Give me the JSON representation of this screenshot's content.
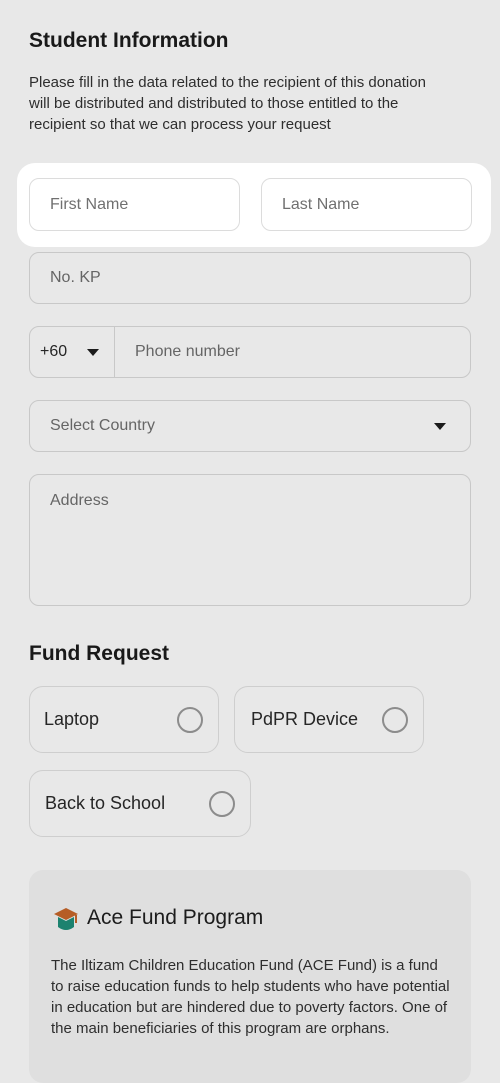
{
  "student_section": {
    "title": "Student Information",
    "description": "Please fill in the data related to the recipient of this donation will be distributed and distributed to those entitled to the recipient so that we can process your request"
  },
  "fields": {
    "first_name_placeholder": "First Name",
    "last_name_placeholder": "Last Name",
    "kp_placeholder": "No. KP",
    "country_code": "+60",
    "phone_placeholder": "Phone number",
    "country_placeholder": "Select Country",
    "address_placeholder": "Address"
  },
  "fund_request": {
    "title": "Fund Request",
    "options": [
      {
        "label": "Laptop",
        "selected": false
      },
      {
        "label": "PdPR Device",
        "selected": false
      },
      {
        "label": "Back to School",
        "selected": false
      }
    ]
  },
  "program_card": {
    "icon": "graduation-cap-icon",
    "title": "Ace Fund Program",
    "text": "The Iltizam Children Education Fund (ACE Fund) is a fund to raise education funds to help students who have potential in education but are hindered due to poverty factors. One of the main beneficiaries of this program are orphans."
  },
  "colors": {
    "dim_overlay": "#e9e9e9",
    "cap_top": "#c9672a",
    "cap_band": "#1f8f7a"
  }
}
